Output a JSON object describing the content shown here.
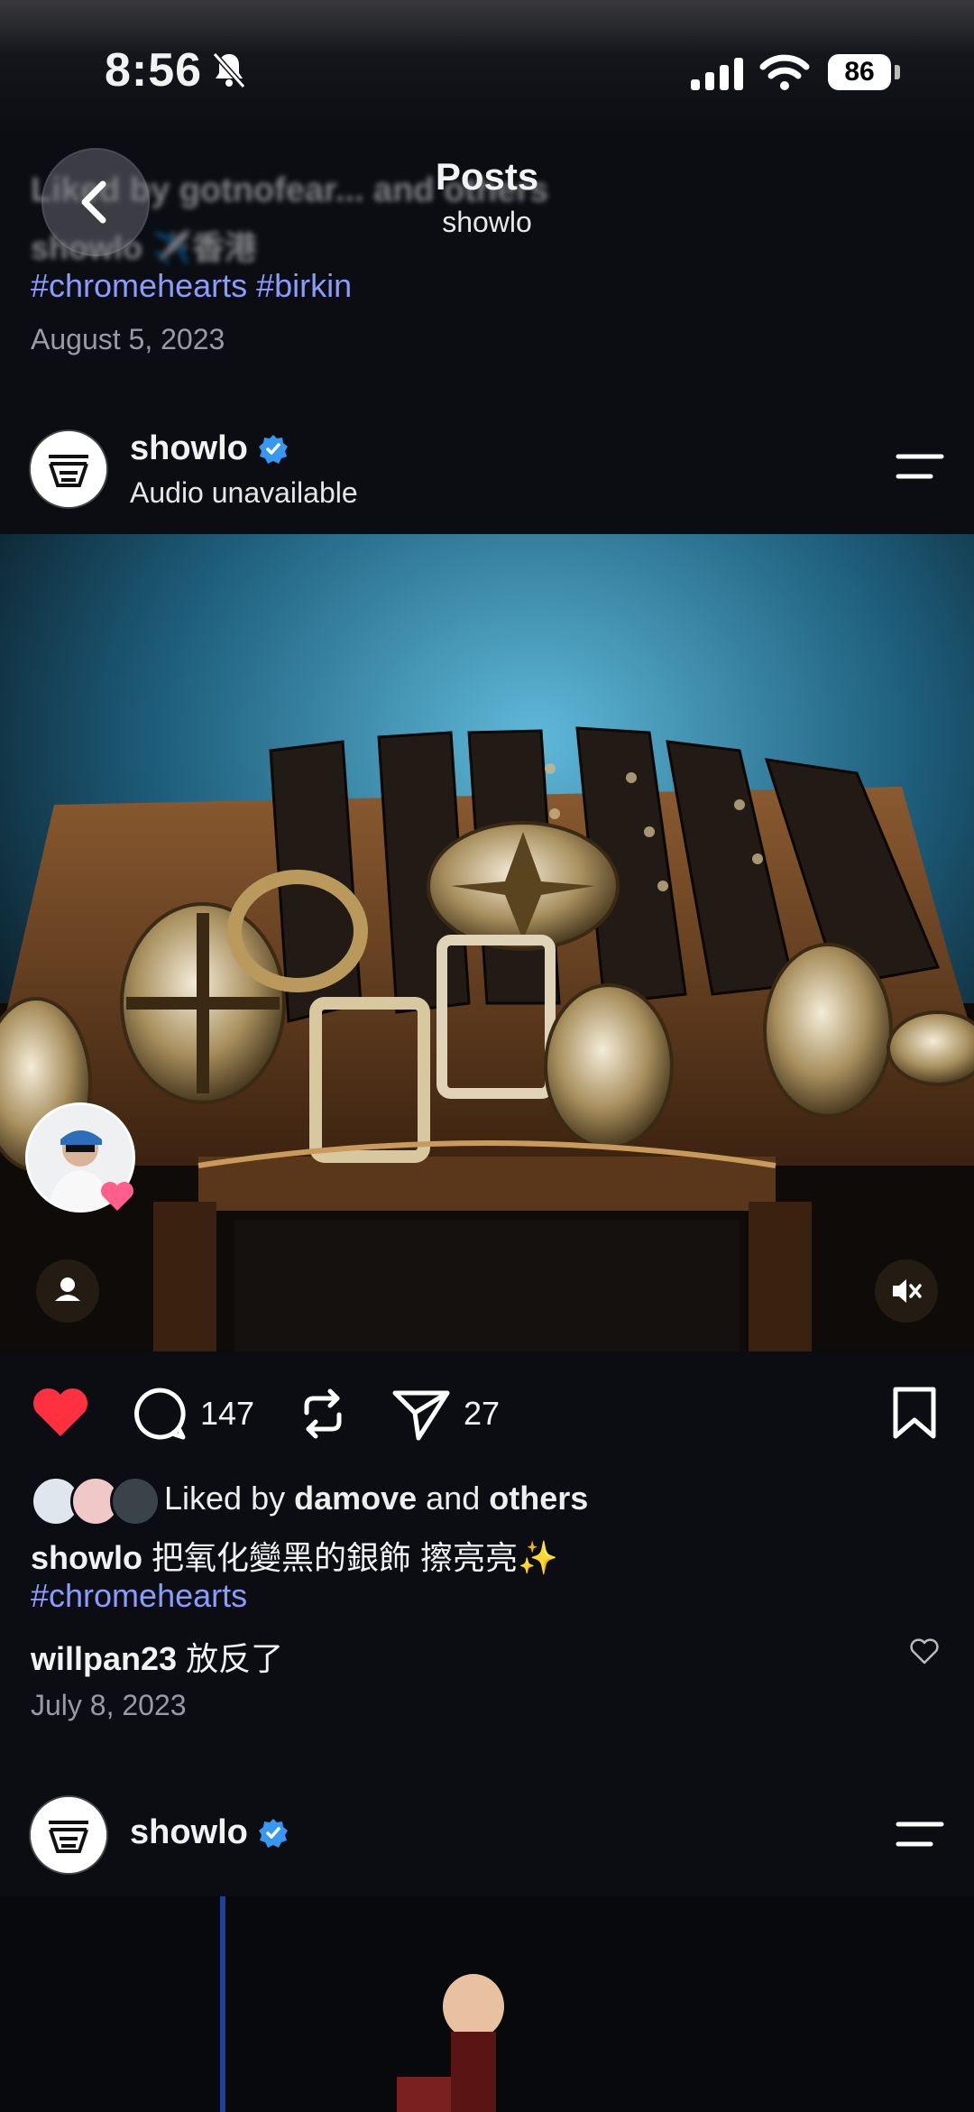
{
  "status_bar": {
    "time": "8:56",
    "battery": "86"
  },
  "header": {
    "title": "Posts",
    "subtitle": "showlo"
  },
  "previous_post": {
    "liked_text": "Liked by gotnofear... and others",
    "caption": "showlo ✈️香港",
    "tags": "#chromehearts #birkin",
    "date": "August 5, 2023"
  },
  "post": {
    "username": "showlo",
    "audio": "Audio unavailable",
    "comments_count": "147",
    "shares_count": "27",
    "liked_prefix": "Liked by ",
    "liked_user": "damove",
    "liked_and": " and ",
    "liked_others": "others",
    "caption_user": "showlo",
    "caption_text": " 把氧化變黑的銀飾 擦亮亮✨",
    "caption_tag": "#chromehearts",
    "comment_user": "willpan23",
    "comment_text": " 放反了",
    "date": "July 8, 2023"
  },
  "next_post": {
    "username": "showlo"
  },
  "colors": {
    "background": "#0b0d13",
    "like": "#ff3040",
    "hashtag": "#8b9cff",
    "verified": "#3897f0"
  }
}
